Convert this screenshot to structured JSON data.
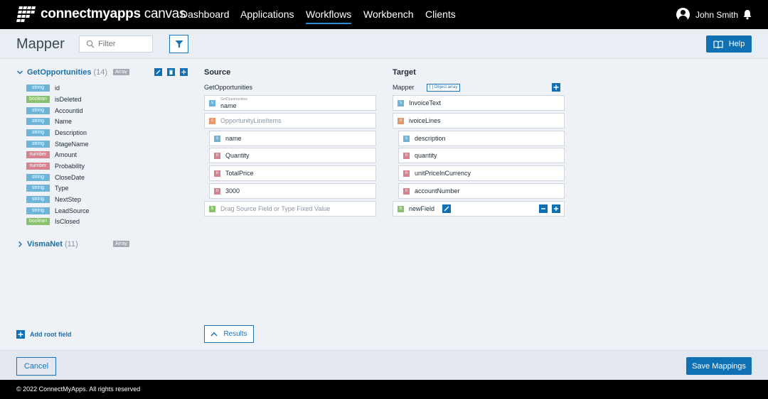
{
  "app": {
    "logo_bold": "connectmyapps",
    "logo_light": " canvas",
    "nav": [
      "Dashboard",
      "Applications",
      "Workflows",
      "Workbench",
      "Clients"
    ],
    "active_nav": "Workflows",
    "user_name": "John Smith",
    "icons": {
      "logo": "grid-logo-icon",
      "user": "user-avatar-icon",
      "bell": "bell-icon"
    }
  },
  "header": {
    "title": "Mapper",
    "filter_placeholder": "Filter",
    "help_label": "Help"
  },
  "tree": {
    "roots": [
      {
        "name": "GetOpportunities",
        "count": "(14)",
        "badge": "Array",
        "expanded": true
      },
      {
        "name": "VismaNet",
        "count": "(11)",
        "badge": "Array",
        "expanded": false
      }
    ],
    "fields": [
      {
        "type": "string",
        "name": "id"
      },
      {
        "type": "boolean",
        "name": "isDeleted"
      },
      {
        "type": "string",
        "name": "Accountid"
      },
      {
        "type": "string",
        "name": "Name"
      },
      {
        "type": "string",
        "name": "Description"
      },
      {
        "type": "string",
        "name": "StageName"
      },
      {
        "type": "number",
        "name": "Amount"
      },
      {
        "type": "number",
        "name": "Probability"
      },
      {
        "type": "string",
        "name": "CloseDate"
      },
      {
        "type": "string",
        "name": "Type"
      },
      {
        "type": "string",
        "name": "NextStep"
      },
      {
        "type": "string",
        "name": "LeadSource"
      },
      {
        "type": "boolean",
        "name": "IsClosed"
      }
    ],
    "add_root_label": "Add root field"
  },
  "source": {
    "title": "Source",
    "subtitle": "GetOpportunities",
    "rows": [
      {
        "letter": "s",
        "small": "GetOpportunities",
        "text": "name"
      },
      {
        "letter": "o",
        "text": "OpportunityLineItems",
        "muted": true
      },
      {
        "letter": "s",
        "text": "name"
      },
      {
        "letter": "n",
        "text": "Quantity"
      },
      {
        "letter": "n",
        "text": "TotalPrice"
      },
      {
        "letter": "n",
        "text": "3000"
      },
      {
        "letter": "b",
        "text": "Drag Source Field or Type Fixed Value",
        "muted": true
      }
    ],
    "results_label": "Results"
  },
  "target": {
    "title": "Target",
    "subtitle": "Mapper",
    "subtitle_badge": "[ ] Object array",
    "rows": [
      {
        "letter": "s",
        "text": "InvoiceText"
      },
      {
        "letter": "o",
        "text": "ivoiceLines"
      },
      {
        "letter": "s",
        "text": "description"
      },
      {
        "letter": "n",
        "text": "quantity"
      },
      {
        "letter": "n",
        "text": "unitPriceInCurrency"
      },
      {
        "letter": "n",
        "text": "accountNumber"
      },
      {
        "letter": "b",
        "text": "newField"
      }
    ]
  },
  "actions": {
    "cancel_label": "Cancel",
    "save_label": "Save Mappings"
  },
  "footer": {
    "copyright": "© 2022 ConnectMyApps. All rights reserved"
  },
  "colors": {
    "accent": "#1070b4",
    "string": "#6fb3d6",
    "boolean": "#8bc06d",
    "number": "#d9808e",
    "object": "#e8956b"
  }
}
